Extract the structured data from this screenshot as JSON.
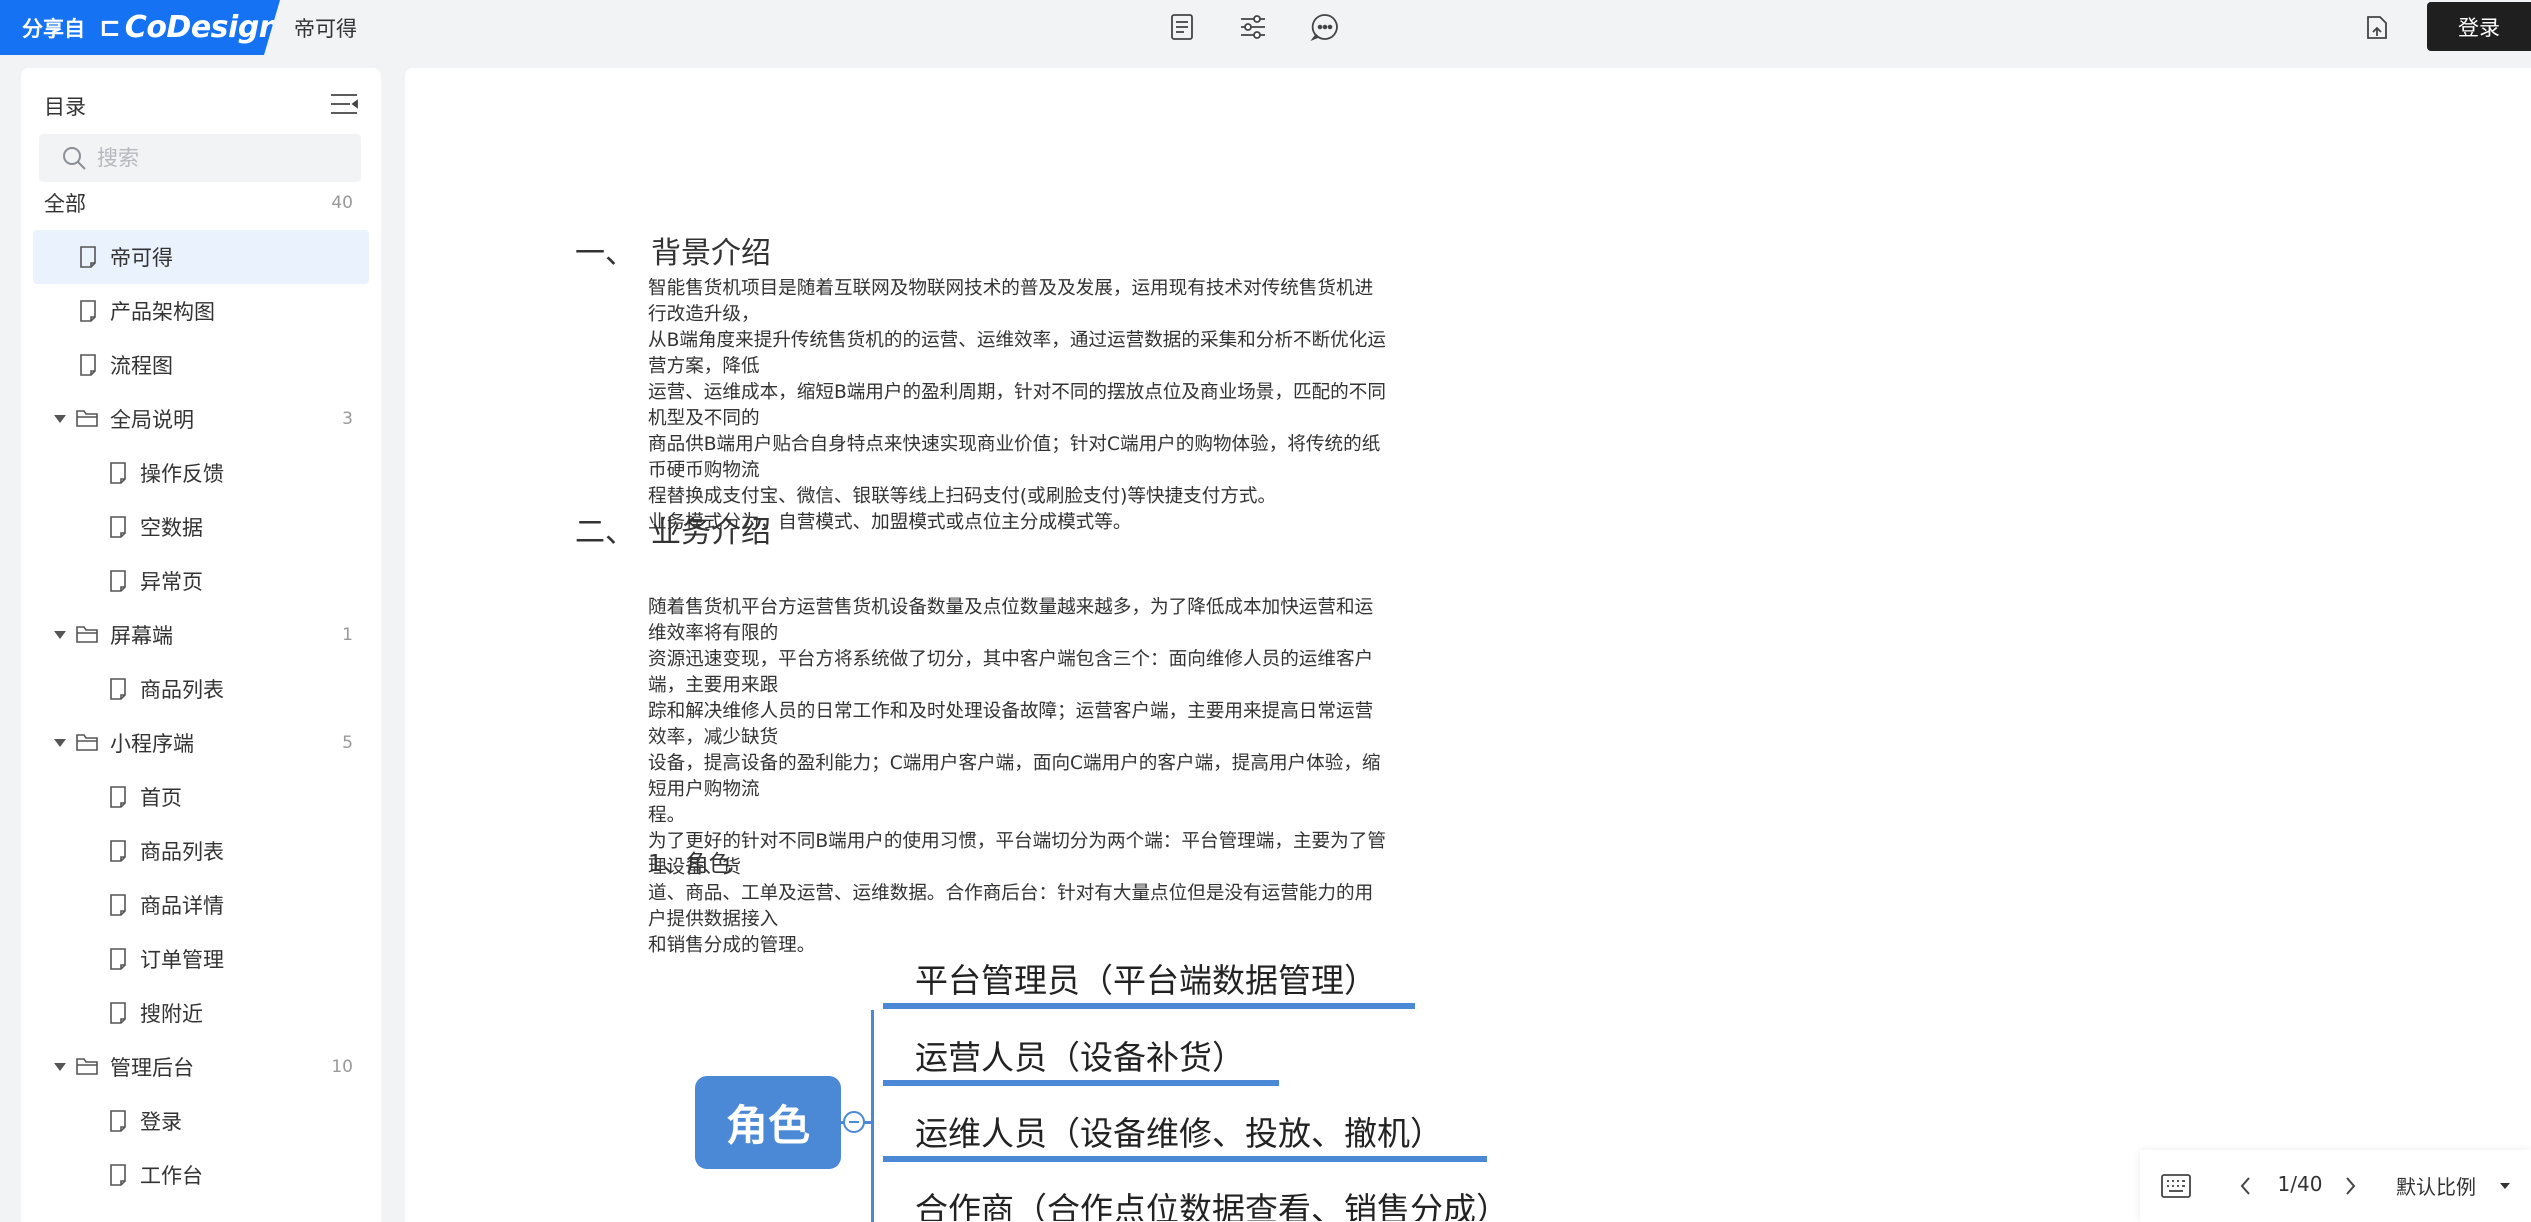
{
  "brand": {
    "share_label": "分享自",
    "logo_glyph": "⊏",
    "logo_name": "CoDesign",
    "color": "#1572f2"
  },
  "header": {
    "doc_title": "帝可得",
    "login_label": "登录",
    "icons": [
      "document-icon",
      "settings-sliders-icon",
      "comment-icon",
      "export-icon"
    ]
  },
  "sidebar": {
    "title": "目录",
    "search_placeholder": "搜索",
    "all_label": "全部",
    "all_count": "40",
    "items": [
      {
        "label": "帝可得",
        "type": "page",
        "level": 1,
        "selected": true
      },
      {
        "label": "产品架构图",
        "type": "page",
        "level": 1
      },
      {
        "label": "流程图",
        "type": "page",
        "level": 1
      },
      {
        "label": "全局说明",
        "type": "folder",
        "level": 1,
        "count": "3"
      },
      {
        "label": "操作反馈",
        "type": "page",
        "level": 2
      },
      {
        "label": "空数据",
        "type": "page",
        "level": 2
      },
      {
        "label": "异常页",
        "type": "page",
        "level": 2
      },
      {
        "label": "屏幕端",
        "type": "folder",
        "level": 1,
        "count": "1"
      },
      {
        "label": "商品列表",
        "type": "page",
        "level": 2
      },
      {
        "label": "小程序端",
        "type": "folder",
        "level": 1,
        "count": "5"
      },
      {
        "label": "首页",
        "type": "page",
        "level": 2
      },
      {
        "label": "商品列表",
        "type": "page",
        "level": 2
      },
      {
        "label": "商品详情",
        "type": "page",
        "level": 2
      },
      {
        "label": "订单管理",
        "type": "page",
        "level": 2
      },
      {
        "label": "搜附近",
        "type": "page",
        "level": 2
      },
      {
        "label": "管理后台",
        "type": "folder",
        "level": 1,
        "count": "10"
      },
      {
        "label": "登录",
        "type": "page",
        "level": 2
      },
      {
        "label": "工作台",
        "type": "page",
        "level": 2
      }
    ]
  },
  "document": {
    "section1": {
      "num": "一、",
      "title": "背景介绍",
      "body": " 智能售货机项目是随着互联网及物联网技术的普及及发展，运用现有技术对传统售货机进行改造升级，\n从B端角度来提升传统售货机的的运营、运维效率，通过运营数据的采集和分析不断优化运营方案，降低\n运营、运维成本，缩短B端用户的盈利周期，针对不同的摆放点位及商业场景，匹配的不同机型及不同的\n商品供B端用户贴合自身特点来快速实现商业价值；针对C端用户的购物体验，将传统的纸币硬币购物流\n程替换成支付宝、微信、银联等线上扫码支付(或刷脸支付)等快捷支付方式。\n业务模式分为，自营模式、加盟模式或点位主分成模式等。"
    },
    "section2": {
      "num": "二、",
      "title": "业务介绍",
      "body": "随着售货机平台方运营售货机设备数量及点位数量越来越多，为了降低成本加快运营和运维效率将有限的\n资源迅速变现，平台方将系统做了切分，其中客户端包含三个：面向维修人员的运维客户端，主要用来跟\n踪和解决维修人员的日常工作和及时处理设备故障；运营客户端，主要用来提高日常运营效率，减少缺货\n设备，提高设备的盈利能力；C端用户客户端，面向C端用户的客户端，提高用户体验，缩短用户购物流\n程。\n为了更好的针对不同B端用户的使用习惯，平台端切分为两个端：平台管理端，主要为了管理设备、货\n道、商品、工单及运营、运维数据。合作商后台：针对有大量点位但是没有运营能力的用户提供数据接入\n和销售分成的管理。",
      "subheading": "1、角色"
    },
    "mindmap": {
      "root": "角色",
      "nodes": [
        "平台管理员（平台端数据管理）",
        "运营人员（设备补货）",
        "运维人员（设备维修、投放、撤机）",
        "合作商（合作点位数据查看、销售分成）"
      ],
      "color": "#4b88d6"
    }
  },
  "pager": {
    "page": "1/40",
    "zoom_label": "默认比例"
  }
}
